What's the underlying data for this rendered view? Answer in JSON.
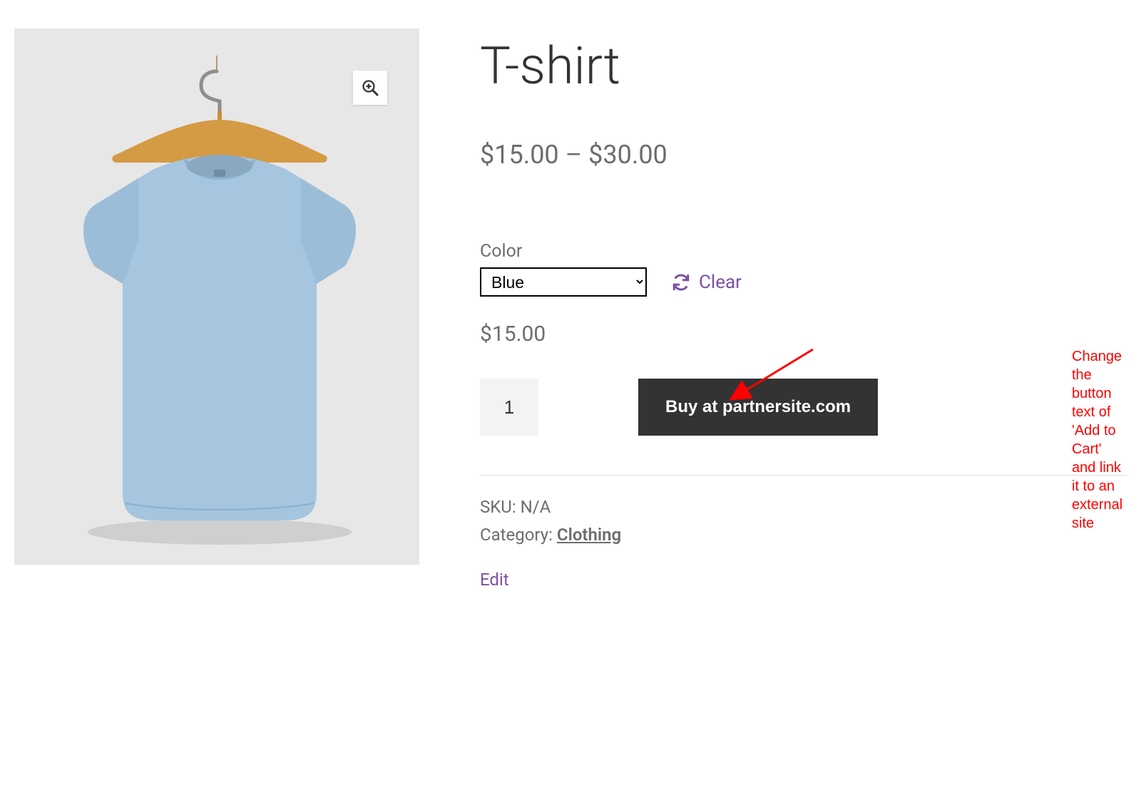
{
  "product": {
    "title": "T-shirt",
    "price_range": "$15.00 – $30.00",
    "variation_price": "$15.00"
  },
  "variation": {
    "label": "Color",
    "selected": "Blue",
    "clear_label": "Clear"
  },
  "cart": {
    "qty": "1",
    "button_label": "Buy at partnersite.com"
  },
  "meta": {
    "sku_label": "SKU:",
    "sku_value": "N/A",
    "category_label": "Category:",
    "category_value": "Clothing"
  },
  "edit_label": "Edit",
  "annotation": {
    "line1": "Change the button text of 'Add to Cart'",
    "line2": "and link it to an external site"
  }
}
